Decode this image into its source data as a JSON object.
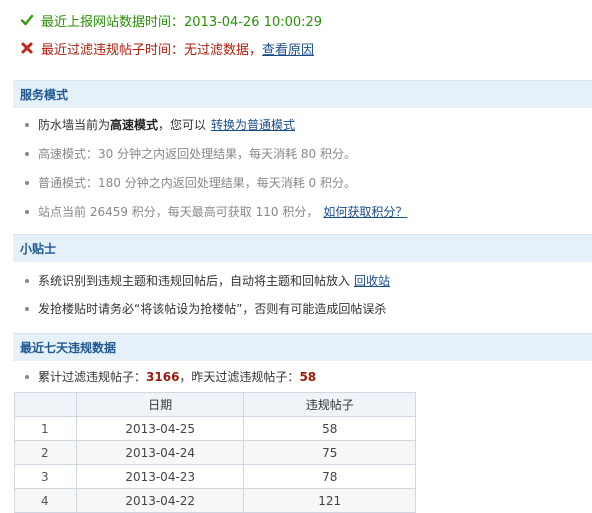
{
  "status": {
    "report_time": "最近上报网站数据时间：2013-04-26 10:00:29",
    "filter_time": "最近过滤违规帖子时间：无过滤数据，",
    "filter_link": "查看原因"
  },
  "service_mode": {
    "title": "服务模式",
    "line1_prefix": "防水墙当前为",
    "line1_mode": "高速模式",
    "line1_mid": "，您可以",
    "line1_link": "转换为普通模式",
    "fast_desc": "高速模式：30 分钟之内返回处理结果，每天消耗 80 积分。",
    "normal_desc": "普通模式：180 分钟之内返回处理结果，每天消耗 0 积分。",
    "points_desc": "站点当前 26459 积分，每天最高可获取 110 积分，",
    "points_link": "如何获取积分？"
  },
  "tips": {
    "title": "小贴士",
    "tip1_prefix": "系统识别到违规主题和违规回帖后，自动将主题和回帖放入",
    "tip1_link": "回收站",
    "tip2": "发抢楼贴时请务必“将该帖设为抢楼帖”，否则有可能造成回帖误杀"
  },
  "recent": {
    "title": "最近七天违规数据",
    "total_label": "累计过滤违规帖子：",
    "total_value": "3166",
    "yesterday_label": "，昨天过滤违规帖子：",
    "yesterday_value": "58",
    "columns": [
      "",
      "日期",
      "违规帖子"
    ],
    "rows": [
      {
        "idx": "1",
        "date": "2013-04-25",
        "count": "58"
      },
      {
        "idx": "2",
        "date": "2013-04-24",
        "count": "75"
      },
      {
        "idx": "3",
        "date": "2013-04-23",
        "count": "78"
      },
      {
        "idx": "4",
        "date": "2013-04-22",
        "count": "121"
      }
    ]
  },
  "colors": {
    "ok": "#2c8f0a",
    "error": "#b01c0c",
    "section_bg": "#e5f0f8",
    "section_text": "#1f5890",
    "highlight_number": "#9b1a0a"
  }
}
